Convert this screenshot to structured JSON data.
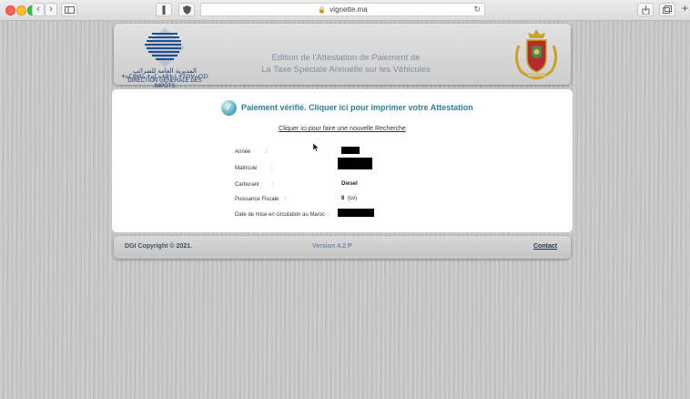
{
  "browser": {
    "url": "vignette.ma"
  },
  "header": {
    "logo_arabic": "المديرية العامة للضرائب",
    "logo_tifinagh": "ⵜⴰⵎⵀⵍⴰ ⵜⴰⵎⴰⵜⵓⵜ ⵏ ⵜⵉⵙⵖⴰⵔⵉⵏ",
    "logo_text": "DIRECTION GÉNÉRALE DES IMPÔTS",
    "title_line1": "Edition de l'Attestation de Paiement de",
    "title_line2": "La Taxe Spéciale Annuelle sur les Véhicules"
  },
  "main": {
    "verified_text": "Paiement vérifié. Cliquer ici pour imprimer votre Attestation",
    "new_search_link": "Cliquer ici pour faire une nouvelle Recherche",
    "fields": {
      "annee_label": "Année",
      "matricule_label": "Matricule",
      "carburant_label": "Carburant",
      "carburant_value": "Diesel",
      "puissance_label": "Puissance Fiscale",
      "puissance_value": "8",
      "puissance_unit": "(cv)",
      "date_label": "Date de mise en circulation au Maroc"
    },
    "colon": ":"
  },
  "footer": {
    "copyright": "DGI Copyright © 2021.",
    "version": "Version 4.2 P",
    "contact": "Contact"
  }
}
